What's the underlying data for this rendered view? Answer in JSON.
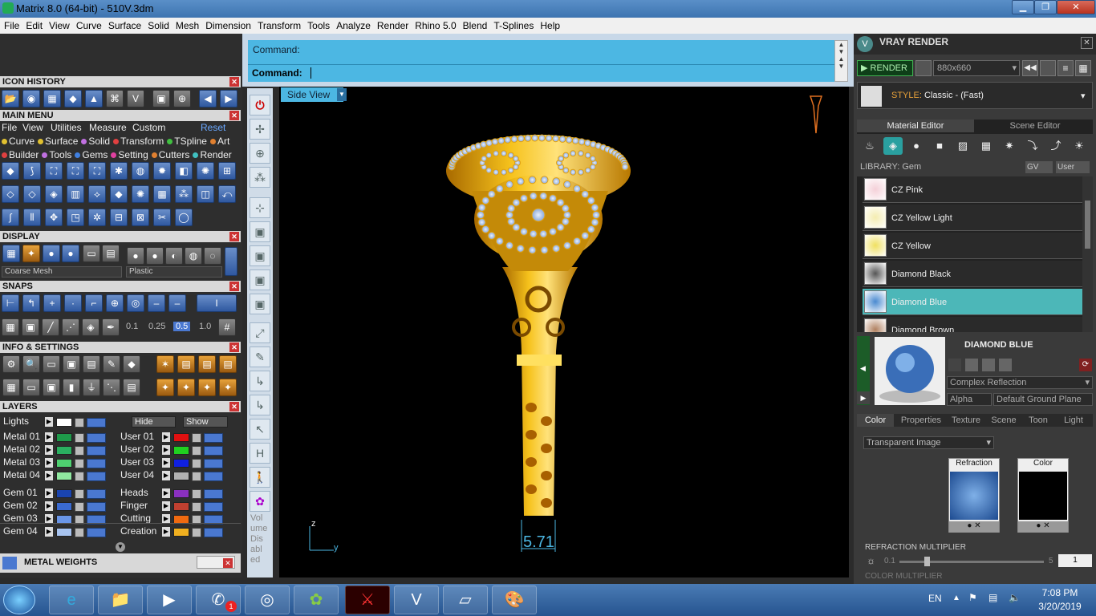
{
  "window": {
    "title": "Matrix 8.0 (64-bit) - 510V.3dm"
  },
  "menu": [
    "File",
    "Edit",
    "View",
    "Curve",
    "Surface",
    "Solid",
    "Mesh",
    "Dimension",
    "Transform",
    "Tools",
    "Analyze",
    "Render",
    "Rhino 5.0",
    "Blend",
    "T-Splines",
    "Help"
  ],
  "icon_history": {
    "title": "ICON HISTORY"
  },
  "main_menu": {
    "title": "MAIN MENU",
    "menu": [
      "File",
      "View",
      "Utilities",
      "Measure",
      "Custom"
    ],
    "reset": "Reset",
    "row1": [
      {
        "label": "Curve",
        "color": "#e0c030"
      },
      {
        "label": "Surface",
        "color": "#e0c030"
      },
      {
        "label": "Solid",
        "color": "#c070e0"
      },
      {
        "label": "Transform",
        "color": "#e04040"
      },
      {
        "label": "TSpline",
        "color": "#40c040"
      },
      {
        "label": "Art",
        "color": "#e08030"
      }
    ],
    "row2": [
      {
        "label": "Builder",
        "color": "#e04040"
      },
      {
        "label": "Tools",
        "color": "#c070e0"
      },
      {
        "label": "Gems",
        "color": "#4080e0"
      },
      {
        "label": "Setting",
        "color": "#e040a0"
      },
      {
        "label": "Cutters",
        "color": "#e08030"
      },
      {
        "label": "Render",
        "color": "#40c0c0"
      }
    ]
  },
  "display": {
    "title": "DISPLAY",
    "mesh": "Coarse Mesh",
    "material": "Plastic"
  },
  "snaps": {
    "title": "SNAPS",
    "values": [
      "0.1",
      "0.25",
      "0.5",
      "1.0"
    ]
  },
  "info": {
    "title": "INFO & SETTINGS"
  },
  "layers": {
    "title": "LAYERS",
    "lights": "Lights",
    "hide": "Hide",
    "show": "Show",
    "left": [
      {
        "name": "Metal 01",
        "color": "#1e9a4a"
      },
      {
        "name": "Metal 02",
        "color": "#2ab060"
      },
      {
        "name": "Metal 03",
        "color": "#4ed070"
      },
      {
        "name": "Metal 04",
        "color": "#90e8a0"
      },
      {
        "name": "Gem 01",
        "color": "#1a44b0"
      },
      {
        "name": "Gem 02",
        "color": "#3a6ad0"
      },
      {
        "name": "Gem 03",
        "color": "#6a96e8"
      },
      {
        "name": "Gem 04",
        "color": "#a8c4f0"
      }
    ],
    "right": [
      {
        "name": "User 01",
        "color": "#e01010"
      },
      {
        "name": "User 02",
        "color": "#20d020"
      },
      {
        "name": "User 03",
        "color": "#1020e0"
      },
      {
        "name": "User 04",
        "color": "#b0b0b0"
      },
      {
        "name": "Heads",
        "color": "#8a30c0"
      },
      {
        "name": "Finger",
        "color": "#c04030"
      },
      {
        "name": "Cutting",
        "color": "#f06a10"
      },
      {
        "name": "Creation",
        "color": "#f0b020"
      }
    ]
  },
  "metal_weights": {
    "title": "METAL WEIGHTS"
  },
  "command": {
    "label_top": "Command:",
    "label_bottom": "Command:"
  },
  "viewport": {
    "view_name": "Side View",
    "dimension": "5.71",
    "axis_z": "z",
    "axis_y": "y",
    "volume_label": [
      "Vol",
      "ume",
      "Dis",
      "abl",
      "ed"
    ]
  },
  "vray": {
    "title": "VRAY RENDER",
    "render": "RENDER",
    "resolution": "880x660",
    "style_label": "STYLE:",
    "style_value": "Classic - (Fast)",
    "tabs": [
      "Material Editor",
      "Scene Editor"
    ],
    "library_label": "LIBRARY: Gem",
    "gv": "GV",
    "user": "User",
    "materials": [
      {
        "name": "CZ Pink",
        "color": "#f4d0d8"
      },
      {
        "name": "CZ Yellow Light",
        "color": "#f4ecb0"
      },
      {
        "name": "CZ Yellow",
        "color": "#f0e060"
      },
      {
        "name": "Diamond Black",
        "color": "#555555"
      },
      {
        "name": "Diamond Blue",
        "color": "#4a8ad0"
      },
      {
        "name": "Diamond Brown",
        "color": "#b08060"
      }
    ],
    "selected_index": 4,
    "preview_title": "DIAMOND BLUE",
    "reflection": "Complex Reflection",
    "alpha": "Alpha",
    "ground": "Default Ground Plane",
    "prop_tabs": [
      "Color",
      "Properties",
      "Texture",
      "Scene",
      "Toon",
      "Light"
    ],
    "transparent": "Transparent Image",
    "refraction_label": "Refraction",
    "color_label": "Color",
    "multiplier_label": "REFRACTION MULTIPLIER",
    "slider_min": "0.1",
    "slider_max": "5",
    "slider_value": "1",
    "color_multiplier": "COLOR MULTIPLIER"
  },
  "taskbar": {
    "lang": "EN",
    "time": "7:08 PM",
    "date": "3/20/2019",
    "badge": "1"
  }
}
